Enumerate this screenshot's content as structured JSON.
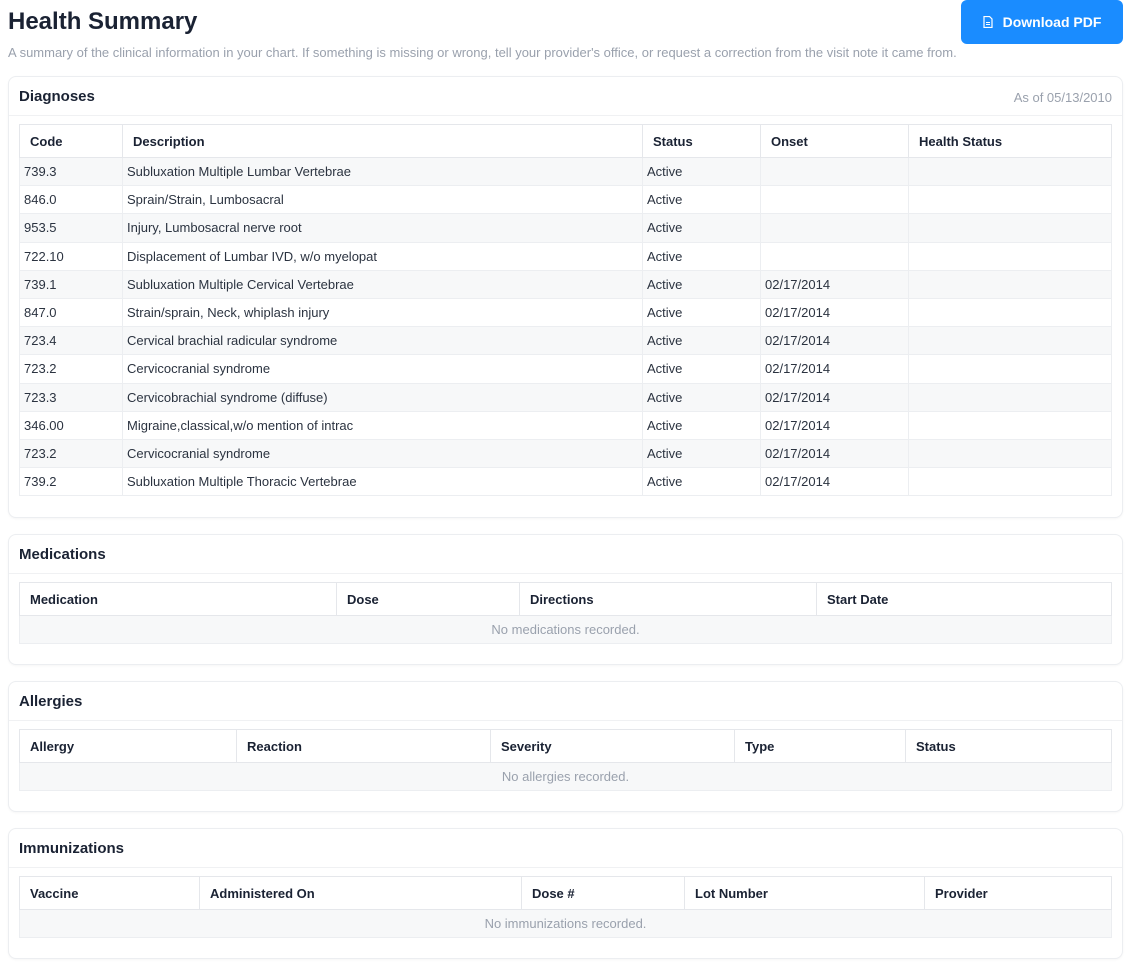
{
  "header": {
    "title": "Health Summary",
    "subtitle": "A summary of the clinical information in your chart. If something is missing or wrong, tell your provider's office, or request a correction from the visit note it came from.",
    "download_label": "Download PDF",
    "download_icon": "document-icon",
    "accent": "#1a8cff"
  },
  "diagnoses": {
    "title": "Diagnoses",
    "as_of": "As of 05/13/2010",
    "columns": [
      "Code",
      "Description",
      "Status",
      "Onset",
      "Health Status"
    ],
    "rows": [
      [
        "739.3",
        "Subluxation Multiple Lumbar Vertebrae",
        "Active",
        "",
        ""
      ],
      [
        "846.0",
        "Sprain/Strain, Lumbosacral",
        "Active",
        "",
        ""
      ],
      [
        "953.5",
        "Injury, Lumbosacral nerve root",
        "Active",
        "",
        ""
      ],
      [
        "722.10",
        "Displacement of Lumbar IVD, w/o myelopat",
        "Active",
        "",
        ""
      ],
      [
        "739.1",
        "Subluxation Multiple Cervical Vertebrae",
        "Active",
        "02/17/2014",
        ""
      ],
      [
        "847.0",
        "Strain/sprain, Neck, whiplash injury",
        "Active",
        "02/17/2014",
        ""
      ],
      [
        "723.4",
        "Cervical brachial radicular syndrome",
        "Active",
        "02/17/2014",
        ""
      ],
      [
        "723.2",
        "Cervicocranial syndrome",
        "Active",
        "02/17/2014",
        ""
      ],
      [
        "723.3",
        "Cervicobrachial syndrome (diffuse)",
        "Active",
        "02/17/2014",
        ""
      ],
      [
        "346.00",
        "Migraine,classical,w/o mention of intrac",
        "Active",
        "02/17/2014",
        ""
      ],
      [
        "723.2",
        "Cervicocranial syndrome",
        "Active",
        "02/17/2014",
        ""
      ],
      [
        "739.2",
        "Subluxation Multiple Thoracic Vertebrae",
        "Active",
        "02/17/2014",
        ""
      ]
    ]
  },
  "medications": {
    "title": "Medications",
    "columns": [
      "Medication",
      "Dose",
      "Directions",
      "Start Date"
    ],
    "empty": "No medications recorded."
  },
  "allergies": {
    "title": "Allergies",
    "columns": [
      "Allergy",
      "Reaction",
      "Severity",
      "Type",
      "Status"
    ],
    "empty": "No allergies recorded."
  },
  "immunizations": {
    "title": "Immunizations",
    "columns": [
      "Vaccine",
      "Administered On",
      "Dose #",
      "Lot Number",
      "Provider"
    ],
    "empty": "No immunizations recorded."
  }
}
